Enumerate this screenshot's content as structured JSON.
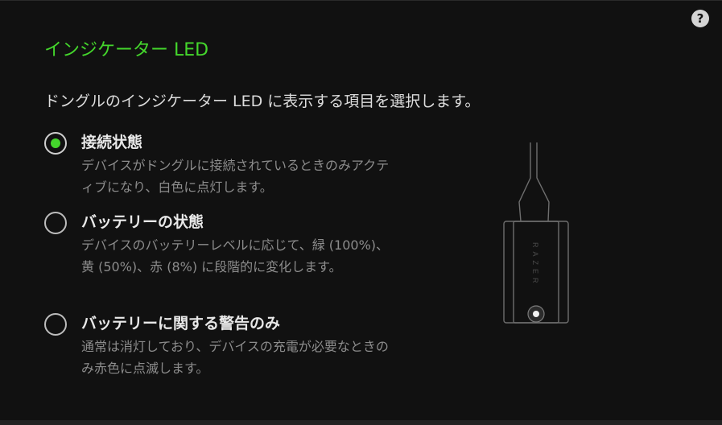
{
  "help": {
    "label": "?"
  },
  "header": {
    "title": "インジケーター LED",
    "description": "ドングルのインジケーター LED に表示する項目を選択します。"
  },
  "options": [
    {
      "label": "接続状態",
      "description": "デバイスがドングルに接続されているときのみアクティブになり、白色に点灯します。",
      "selected": true
    },
    {
      "label": "バッテリーの状態",
      "description": "デバイスのバッテリーレベルに応じて、緑 (100%)、黄 (50%)、赤 (8%) に段階的に変化します。",
      "selected": false
    },
    {
      "label": "バッテリーに関する警告のみ",
      "description": "通常は消灯しており、デバイスの充電が必要なときのみ赤色に点滅します。",
      "selected": false
    }
  ],
  "illustration": {
    "brand_text": "RAZER"
  },
  "colors": {
    "accent": "#44d62c",
    "background": "#111111",
    "text": "#dddddd",
    "muted_text": "#8c8c8c"
  }
}
